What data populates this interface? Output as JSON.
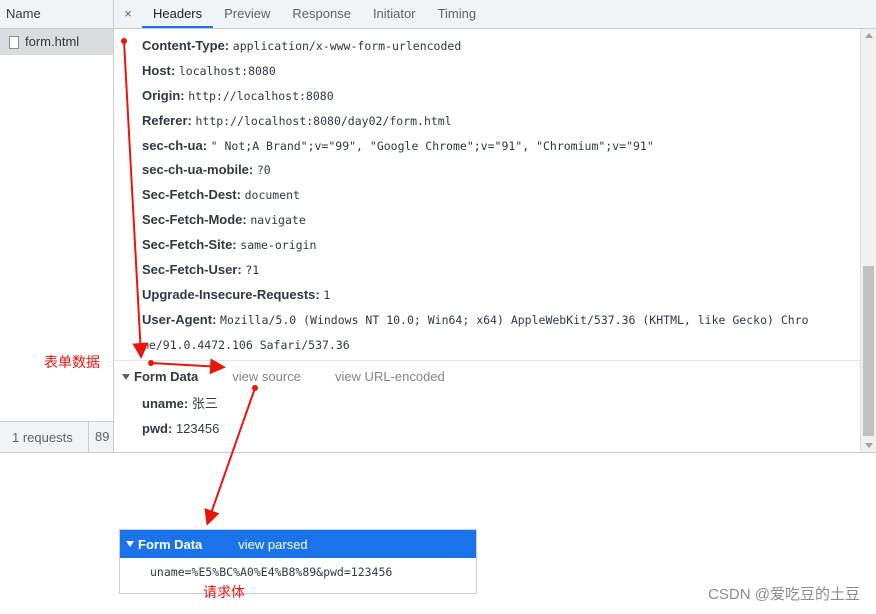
{
  "request_list": {
    "header": "Name",
    "items": [
      {
        "label": "form.html"
      }
    ],
    "footer_requests": "1 requests",
    "footer_size": "89"
  },
  "tabs": {
    "close": "×",
    "items": [
      "Headers",
      "Preview",
      "Response",
      "Initiator",
      "Timing"
    ],
    "active": "Headers"
  },
  "headers": [
    {
      "key": "Content-Type:",
      "value": "application/x-www-form-urlencoded"
    },
    {
      "key": "Host:",
      "value": "localhost:8080"
    },
    {
      "key": "Origin:",
      "value": "http://localhost:8080"
    },
    {
      "key": "Referer:",
      "value": "http://localhost:8080/day02/form.html"
    },
    {
      "key": "sec-ch-ua:",
      "value": "\" Not;A Brand\";v=\"99\", \"Google Chrome\";v=\"91\", \"Chromium\";v=\"91\""
    },
    {
      "key": "sec-ch-ua-mobile:",
      "value": "?0"
    },
    {
      "key": "Sec-Fetch-Dest:",
      "value": "document"
    },
    {
      "key": "Sec-Fetch-Mode:",
      "value": "navigate"
    },
    {
      "key": "Sec-Fetch-Site:",
      "value": "same-origin"
    },
    {
      "key": "Sec-Fetch-User:",
      "value": "?1"
    },
    {
      "key": "Upgrade-Insecure-Requests:",
      "value": "1"
    },
    {
      "key": "User-Agent:",
      "value": "Mozilla/5.0 (Windows NT 10.0; Win64; x64) AppleWebKit/537.36 (KHTML, like Gecko) Chro"
    },
    {
      "key": "",
      "value": "me/91.0.4472.106 Safari/537.36"
    }
  ],
  "form_data": {
    "title": "Form Data",
    "view_source": "view source",
    "view_url_encoded": "view URL-encoded",
    "fields": [
      {
        "key": "uname:",
        "value": "张三"
      },
      {
        "key": "pwd:",
        "value": "123456"
      }
    ]
  },
  "snippet": {
    "title": "Form Data",
    "link": "view parsed",
    "body": "uname=%E5%BC%A0%E4%B8%89&pwd=123456"
  },
  "annotations": {
    "form_data_label": "表单数据",
    "request_body_label": "请求体",
    "color": "#e8170e"
  },
  "watermark": "CSDN @爱吃豆的土豆",
  "colors": {
    "accent": "#1a73e8",
    "annotation": "#e8170e"
  }
}
